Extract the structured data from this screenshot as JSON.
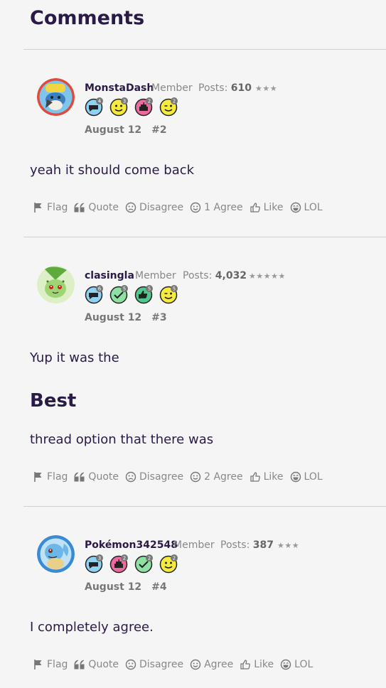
{
  "heading": "Comments",
  "colors": {
    "text": "#2a1a48",
    "muted": "#888888",
    "divider": "#d0d0d0"
  },
  "posts": [
    {
      "username": "MonstaDash",
      "role": "Member",
      "posts_label": "Posts:",
      "posts_count": "610",
      "stars": "★★★",
      "date": "August 12",
      "post_number": "#2",
      "badges": [
        {
          "icon": "speech-bubble-badge-icon",
          "count": "4"
        },
        {
          "icon": "smiley-badge-icon",
          "count": "3"
        },
        {
          "icon": "cake-badge-icon",
          "count": "2"
        },
        {
          "icon": "wink-badge-icon",
          "count": "2"
        }
      ],
      "body": [
        "yeah it should come back"
      ],
      "actions": {
        "flag": "Flag",
        "quote": "Quote",
        "disagree": "Disagree",
        "agree": "1 Agree",
        "like": "Like",
        "lol": "LOL"
      }
    },
    {
      "username": "clasingla",
      "role": "Member",
      "posts_label": "Posts:",
      "posts_count": "4,032",
      "stars": "★★★★★",
      "date": "August 12",
      "post_number": "#3",
      "badges": [
        {
          "icon": "speech-bubble-badge-icon",
          "count": "6"
        },
        {
          "icon": "check-badge-icon",
          "count": "5"
        },
        {
          "icon": "thumbs-up-badge-icon",
          "count": "5"
        },
        {
          "icon": "wink-badge-icon",
          "count": "5"
        }
      ],
      "body_intro": "Yup it was the",
      "body_heading": "Best",
      "body_outro": "thread option that there was",
      "actions": {
        "flag": "Flag",
        "quote": "Quote",
        "disagree": "Disagree",
        "agree": "2 Agree",
        "like": "Like",
        "lol": "LOL"
      }
    },
    {
      "username": "Pokémon342548",
      "role": "Member",
      "posts_label": "Posts:",
      "posts_count": "387",
      "stars": "★★★",
      "date": "August 12",
      "post_number": "#4",
      "badges": [
        {
          "icon": "speech-bubble-badge-icon",
          "count": "3"
        },
        {
          "icon": "cake-badge-icon",
          "count": "2"
        },
        {
          "icon": "check-badge-icon",
          "count": "2"
        },
        {
          "icon": "smiley-badge-icon",
          "count": "2"
        }
      ],
      "body": [
        "I completely agree."
      ],
      "actions": {
        "flag": "Flag",
        "quote": "Quote",
        "disagree": "Disagree",
        "agree": "Agree",
        "like": "Like",
        "lol": "LOL"
      }
    }
  ]
}
